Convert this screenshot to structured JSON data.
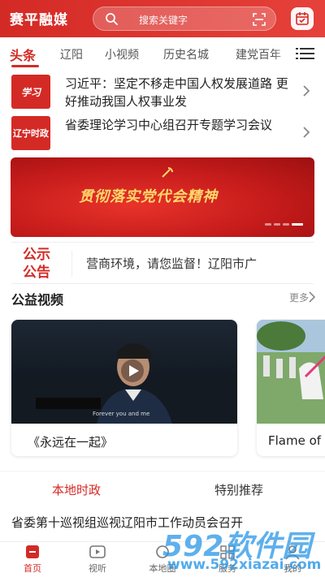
{
  "header": {
    "app_title": "赛平融媒",
    "search_placeholder": "搜索关键字",
    "accent": "#d42a26"
  },
  "tabs": [
    {
      "label": "头条",
      "active": true
    },
    {
      "label": "辽阳",
      "active": false
    },
    {
      "label": "小视频",
      "active": false
    },
    {
      "label": "历史名城",
      "active": false
    },
    {
      "label": "建党百年",
      "active": false
    }
  ],
  "headlines": [
    {
      "logo_text": "学习",
      "title": "习近平：坚定不移走中国人权发展道路 更好推动我国人权事业发"
    },
    {
      "logo_text": "辽宁时政",
      "title": "省委理论学习中心组召开专题学习会议"
    }
  ],
  "banner": {
    "text": "贯彻落实党代会精神"
  },
  "notice": {
    "label": "公示公告",
    "text": "营商环境，请您监督！辽阳市广"
  },
  "section": {
    "title": "公益视频",
    "more": "更多"
  },
  "videos": [
    {
      "caption": "《永远在一起》",
      "subtitle": "Forever you and me"
    },
    {
      "caption": "Flame of"
    }
  ],
  "categories": [
    {
      "label": "本地时政",
      "active": true
    },
    {
      "label": "特别推荐",
      "active": false
    }
  ],
  "bottom_headline": "省委第十巡视组巡视辽阳市工作动员会召开",
  "bottom_nav": [
    {
      "label": "首页",
      "icon": "home-icon",
      "active": true
    },
    {
      "label": "视听",
      "icon": "video-icon",
      "active": false
    },
    {
      "label": "本地圈",
      "icon": "circle-icon",
      "active": false
    },
    {
      "label": "服务",
      "icon": "service-icon",
      "active": false
    },
    {
      "label": "我的",
      "icon": "profile-icon",
      "active": false
    }
  ],
  "watermark": {
    "brand": "592软件园",
    "url": "www.592xiazai.com"
  }
}
